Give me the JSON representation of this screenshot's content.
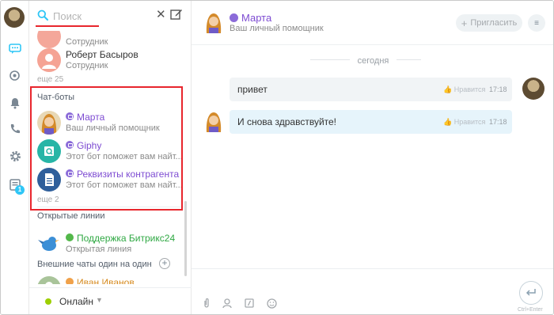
{
  "search": {
    "placeholder": "Поиск",
    "value": ""
  },
  "contacts_top": [
    {
      "name": "",
      "role": "Сотрудник"
    },
    {
      "name": "Роберт Басыров",
      "role": "Сотрудник"
    }
  ],
  "more_contacts": "еще 25",
  "chatbots": {
    "title": "Чат-боты",
    "items": [
      {
        "name": "Марта",
        "desc": "Ваш личный помощник"
      },
      {
        "name": "Giphy",
        "desc": "Этот бот поможет вам найт..."
      },
      {
        "name": "Реквизиты контрагента",
        "desc": "Этот бот поможет вам найт..."
      }
    ],
    "more": "еще 2"
  },
  "open_lines": {
    "title": "Открытые линии",
    "items": [
      {
        "name": "Поддержка Битрикс24",
        "desc": "Открытая линия"
      }
    ]
  },
  "external": {
    "title": "Внешние чаты один на один",
    "items": [
      {
        "name": "Иван Иванов"
      }
    ]
  },
  "status": {
    "label": "Онлайн"
  },
  "rail": {
    "badge": "1"
  },
  "chat": {
    "title": "Марта",
    "subtitle": "Ваш личный помощник",
    "invite_label": "Пригласить",
    "date_label": "сегодня",
    "messages": [
      {
        "text": "привет",
        "like": "Нравится",
        "time": "17:18"
      },
      {
        "text": "И снова здравствуйте!",
        "like": "Нравится",
        "time": "17:18"
      }
    ],
    "send_hint": "Ctrl+Enter"
  },
  "colors": {
    "accent": "#2fc6f6",
    "bot": "#7d4bd2",
    "open_line": "#2fa843",
    "highlight": "#e8262d"
  }
}
